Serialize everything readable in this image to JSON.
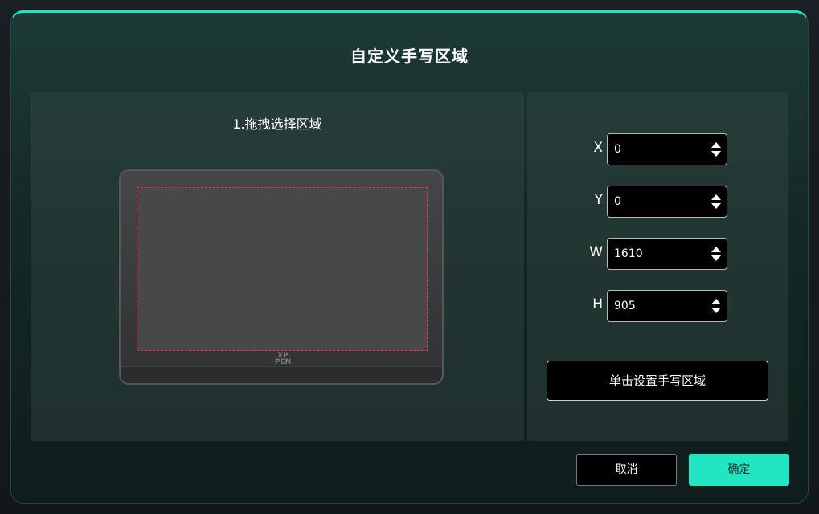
{
  "dialog": {
    "title": "自定义手写区域"
  },
  "area_panel": {
    "heading": "1.拖拽选择区域",
    "brand_logo": "XP\nPEN"
  },
  "fields": [
    {
      "label": "X",
      "value": "0"
    },
    {
      "label": "Y",
      "value": "0"
    },
    {
      "label": "W",
      "value": "1610"
    },
    {
      "label": "H",
      "value": "905"
    }
  ],
  "actions": {
    "set_area_label": "单击设置手写区域",
    "cancel_label": "取消",
    "ok_label": "确定"
  },
  "colors": {
    "accent": "#22e6c3",
    "selection_border": "#ff2b2b"
  }
}
